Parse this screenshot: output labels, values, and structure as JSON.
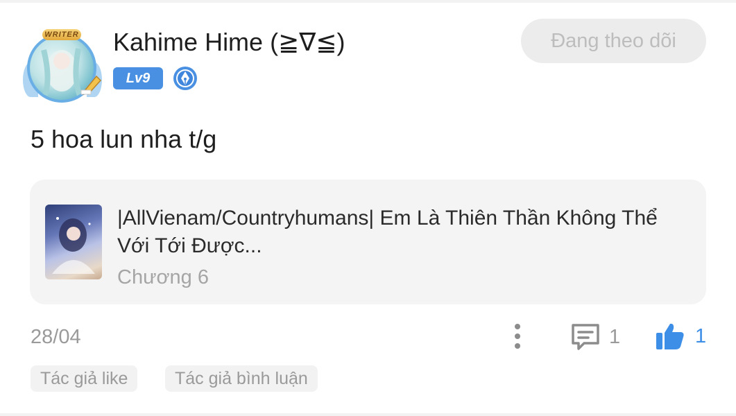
{
  "header": {
    "username": "Kahime Hime (≧∇≦)",
    "level_badge": "Lv9",
    "avatar_frame_label": "WRITER",
    "follow_button": "Đang theo dõi"
  },
  "comment": {
    "text": "5 hoa lun nha t/g"
  },
  "story_card": {
    "title": "|AllVienam/Countryhumans| Em Là Thiên Thần Không Thể Với Tới Được...",
    "chapter": "Chương 6"
  },
  "footer": {
    "date": "28/04",
    "comment_count": "1",
    "like_count": "1",
    "tags": [
      "Tác giả like",
      "Tác giả bình luận"
    ]
  },
  "colors": {
    "accent": "#3d8ee6",
    "level_badge": "#4a90e2",
    "card_bg": "#f4f4f5",
    "muted_text": "#9a9a9a"
  },
  "icons": {
    "more": "vertical-ellipsis-icon",
    "comment": "comment-bubble-icon",
    "like": "thumbs-up-icon",
    "writer_badge": "pen-nib-badge-icon"
  }
}
